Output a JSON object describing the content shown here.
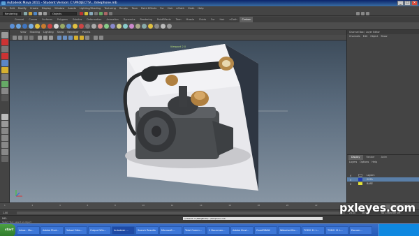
{
  "window": {
    "title": "Autodesk Maya 2011 - Student Version: C:\\PROJECTS\\...\\telephone.mb",
    "buttons": [
      "_",
      "□",
      "×"
    ]
  },
  "menubar": {
    "items": [
      "File",
      "Edit",
      "Modify",
      "Create",
      "Display",
      "Window",
      "Assets",
      "Lighting/Shading",
      "Texturing",
      "Render",
      "Toon",
      "Paint Effects",
      "Fur",
      "Hair",
      "nCloth",
      "Cloth",
      "Help"
    ]
  },
  "statusline": {
    "mode": "Rendering",
    "object_field": "Objects"
  },
  "shelf": {
    "tabs": [
      "General",
      "Curves",
      "Surfaces",
      "Polygons",
      "Subdivs",
      "Deformation",
      "Animation",
      "Dynamics",
      "Rendering",
      "PaintEffects",
      "Toon",
      "Muscle",
      "Fluids",
      "Fur",
      "Hair",
      "nCloth",
      "Custom"
    ],
    "active_tab": "Custom"
  },
  "viewport": {
    "menus": [
      "View",
      "Shading",
      "Lighting",
      "Show",
      "Renderer",
      "Panels"
    ],
    "camera_label": "Viewport 2.0"
  },
  "channel_box": {
    "header": "Channel Box / Layer Editor",
    "menus": [
      "Channels",
      "Edit",
      "Object",
      "Show"
    ]
  },
  "layer_editor": {
    "tabs": [
      "Display",
      "Render",
      "Anim"
    ],
    "active_tab": "Display",
    "menus": [
      "Layers",
      "Options",
      "Help"
    ],
    "layers": [
      {
        "visible": "V",
        "name": "Layer1",
        "color": "#444444",
        "selected": false
      },
      {
        "visible": "V",
        "name": "SOFA",
        "color": "#1f3ab5",
        "selected": true
      },
      {
        "visible": "V",
        "name": "BASE",
        "color": "#e2e23a",
        "selected": false
      }
    ]
  },
  "timeline": {
    "ticks": [
      "1",
      "2",
      "4",
      "6",
      "8",
      "10",
      "12",
      "14",
      "16",
      "18",
      "20",
      "22",
      "24"
    ]
  },
  "range_slider": {
    "start": "1.00",
    "end": "24.00",
    "anim_end": "48.00",
    "char_set": "No Character Set"
  },
  "command_line": {
    "type": "MEL",
    "result": "// Result: C:/PROJECTS/.../telephone.mb",
    "help": "Select Tool: select an object"
  },
  "taskbar": {
    "start": "start",
    "tasks": [
      {
        "label": "Inbox - Mo...",
        "active": false
      },
      {
        "label": "Adobe Phot...",
        "active": false
      },
      {
        "label": "Yahoo! Mes...",
        "active": false
      },
      {
        "label": "Output Win...",
        "active": false
      },
      {
        "label": "Autodesk ...",
        "active": true
      },
      {
        "label": "Search Results",
        "active": false
      },
      {
        "label": "Microsoft ...",
        "active": false
      },
      {
        "label": "Total Comm...",
        "active": false
      },
      {
        "label": "2 Documen...",
        "active": false
      },
      {
        "label": "Adobe Illust...",
        "active": false
      },
      {
        "label": "CorelDRAW",
        "active": false
      },
      {
        "label": "Webshot Mo...",
        "active": false
      },
      {
        "label": "TODO 11 L...",
        "active": false
      },
      {
        "label": "TODO 11 L...",
        "active": false
      },
      {
        "label": "Docum...",
        "active": false
      }
    ]
  },
  "watermark": "pxleyes.com",
  "colors": {
    "ui_bg": "#444444",
    "viewport_top": "#3d4c5b",
    "viewport_bottom": "#8795a3",
    "taskbar": "#245ab8",
    "selection": "#5a7fa8"
  }
}
